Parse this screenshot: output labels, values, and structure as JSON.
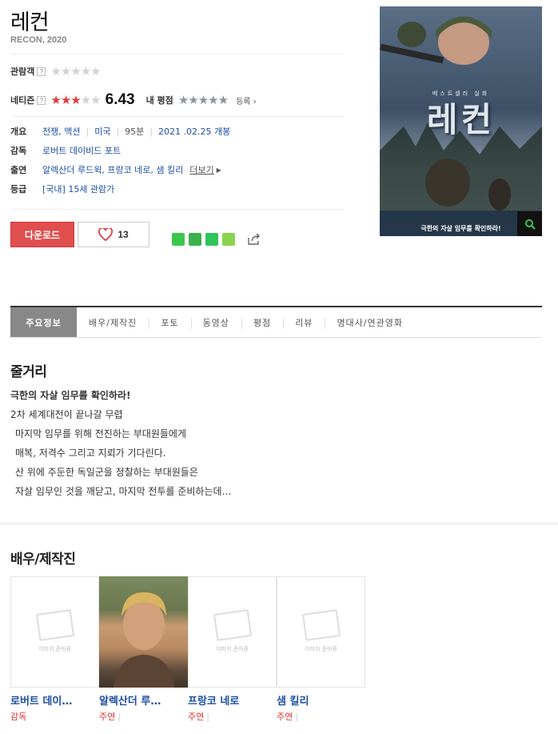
{
  "movie": {
    "title": "레컨",
    "subtitle": "RECON, 2020"
  },
  "ratings": {
    "audience_label": "관람객",
    "audience_stars": 0,
    "netizen_label": "네티즌",
    "netizen_score": "6.43",
    "netizen_stars": 3.2,
    "my_label": "내 평점",
    "register_label": "등록",
    "help_mark": "?"
  },
  "info": {
    "overview_label": "개요",
    "genre": "전쟁, 액션",
    "country": "미국",
    "runtime": "95분",
    "release": "2021 .02.25 개봉",
    "director_label": "감독",
    "director": "로버트 데이비드 포트",
    "cast_label": "출연",
    "cast": "알렉산더 루드윅, 프랑코 네로, 샘 킬리",
    "more_label": "더보기",
    "grade_label": "등급",
    "grade": "[국내] 15세 관람가"
  },
  "actions": {
    "download_label": "다운로드",
    "like_count": "13"
  },
  "poster": {
    "tagline": "베스트셀러 실화",
    "title": "레컨",
    "caption": "극한의 자살 임무를 확인하라!"
  },
  "tabs": [
    "주요정보",
    "배우/제작진",
    "포토",
    "동영상",
    "평점",
    "리뷰",
    "명대사/연관영화"
  ],
  "synopsis": {
    "heading": "줄거리",
    "lines": [
      "극한의 자살 임무를 확인하라!",
      "2차 세계대전이 끝나갈 무렵",
      "  마지막 임무를 위해 전진하는 부대원들에게",
      "  매복, 저격수 그리고 지뢰가 기다린다.",
      "  산 위에 주둔한 독일군을 정찰하는 부대원들은",
      "  자살 임무인 것을 깨닫고, 마지막 전투를 준비하는데…"
    ]
  },
  "cast_section": {
    "heading": "배우/제작진",
    "placeholder_text": "이미지 준비중",
    "people": [
      {
        "name": "로버트 데이…",
        "role": "감독",
        "has_photo": false
      },
      {
        "name": "알렉산더 루…",
        "role": "주연",
        "has_photo": true
      },
      {
        "name": "프랑코 네로",
        "role": "주연",
        "has_photo": false
      },
      {
        "name": "샘 킬리",
        "role": "주연",
        "has_photo": false
      }
    ]
  },
  "colors": {
    "accent_red": "#e04e4e",
    "link_blue": "#1b4ea2",
    "star_red": "#e03c3c"
  }
}
